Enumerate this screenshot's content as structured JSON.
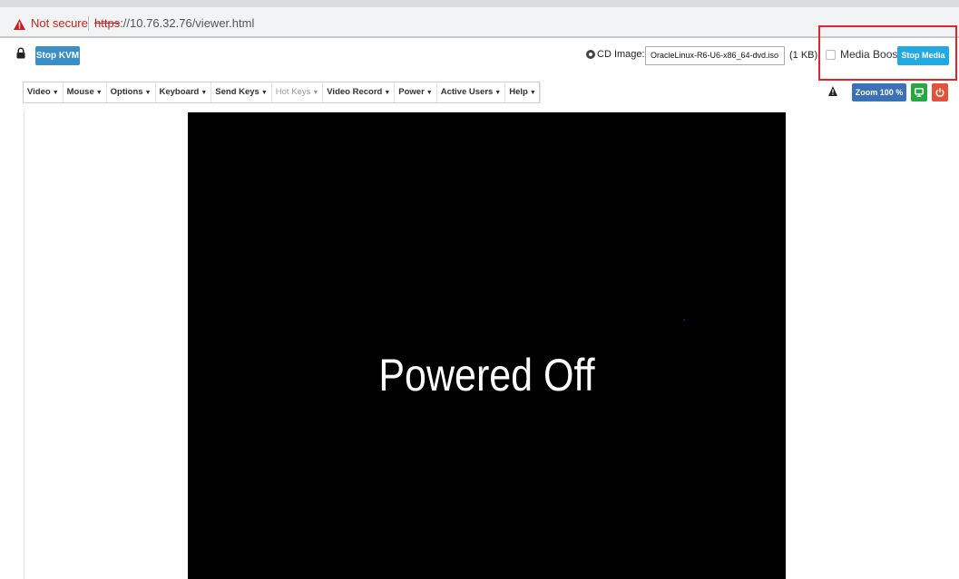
{
  "browser": {
    "warning_text": "Not secure",
    "url_scheme": "https",
    "url_rest": "://10.76.32.76/viewer.html"
  },
  "kvm": {
    "stop_kvm_label": "Stop KVM",
    "cd_image_label": "CD Image:",
    "cd_image_file": "OracleLinux-R6-U6-x86_64-dvd.iso",
    "cd_image_size": "(1 KB)",
    "media_boost_label": "Media Boost",
    "media_boost_checked": false,
    "stop_media_label": "Stop Media",
    "menu": [
      {
        "label": "Video"
      },
      {
        "label": "Mouse"
      },
      {
        "label": "Options"
      },
      {
        "label": "Keyboard"
      },
      {
        "label": "Send Keys"
      },
      {
        "label": "Hot Keys",
        "disabled": true
      },
      {
        "label": "Video Record"
      },
      {
        "label": "Power"
      },
      {
        "label": "Active Users"
      },
      {
        "label": "Help"
      }
    ],
    "zoom_label": "Zoom 100 %",
    "viewer_text": "Powered Off"
  },
  "colors": {
    "primary_blue": "#3a8fc4",
    "stop_media_blue": "#23a9e1",
    "highlight_red": "#e0262c",
    "green": "#29a744",
    "red": "#e2533c"
  },
  "icons": [
    "warning-icon",
    "lock-icon",
    "cd-icon",
    "alert-icon",
    "monitor-icon",
    "power-icon"
  ]
}
